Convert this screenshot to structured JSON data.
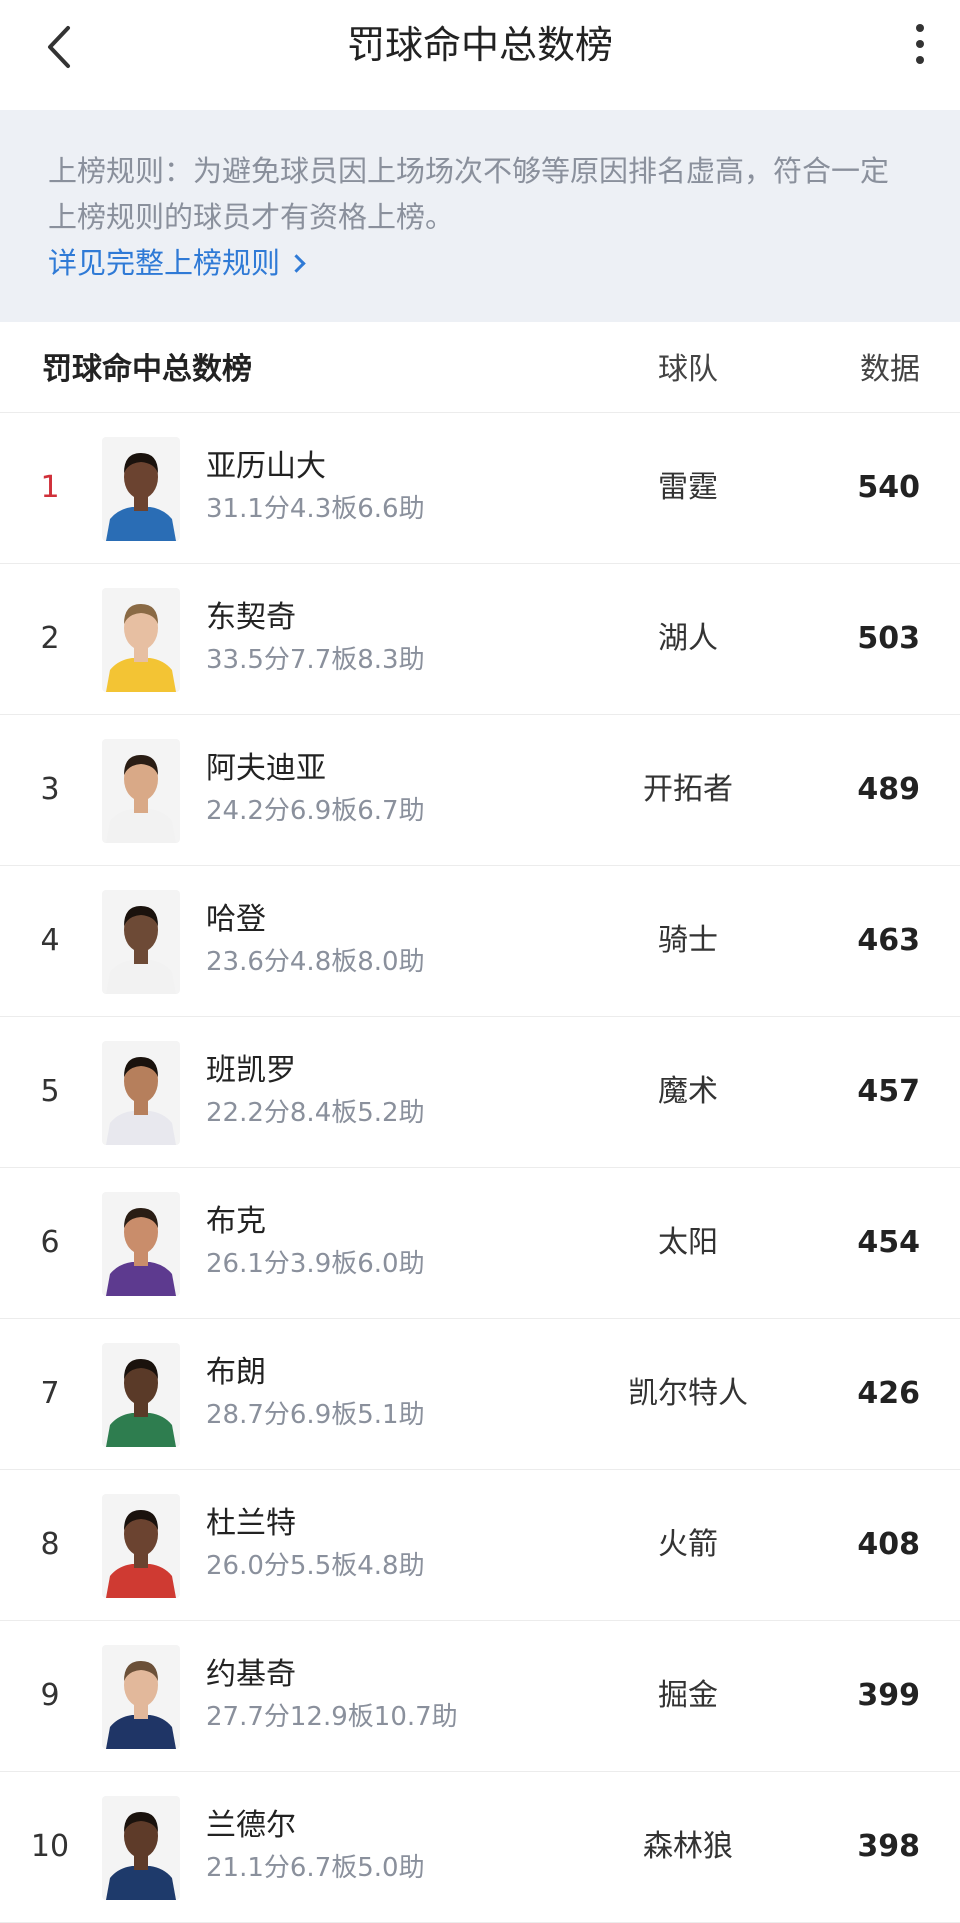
{
  "top_bar": {
    "title": "罚球命中总数榜"
  },
  "rules": {
    "text": "上榜规则：为避免球员因上场场次不够等原因排名虚高，符合一定上榜规则的球员才有资格上榜。",
    "link_label": "详见完整上榜规则"
  },
  "table": {
    "title": "罚球命中总数榜",
    "team_header": "球队",
    "stat_header": "数据"
  },
  "players": [
    {
      "rank": "1",
      "name": "亚历山大",
      "stats": "31.1分4.3板6.6助",
      "team": "雷霆",
      "value": "540",
      "skin": "#6b4330",
      "jersey": "#2a6db5",
      "hair": "#1a120d"
    },
    {
      "rank": "2",
      "name": "东契奇",
      "stats": "33.5分7.7板8.3助",
      "team": "湖人",
      "value": "503",
      "skin": "#e7bfa2",
      "jersey": "#f3c434",
      "hair": "#8a6a45"
    },
    {
      "rank": "3",
      "name": "阿夫迪亚",
      "stats": "24.2分6.9板6.7助",
      "team": "开拓者",
      "value": "489",
      "skin": "#d9a987",
      "jersey": "#f2f2f2",
      "hair": "#2a1d14"
    },
    {
      "rank": "4",
      "name": "哈登",
      "stats": "23.6分4.8板8.0助",
      "team": "骑士",
      "value": "463",
      "skin": "#6d4a36",
      "jersey": "#f2f2f2",
      "hair": "#1a120d"
    },
    {
      "rank": "5",
      "name": "班凯罗",
      "stats": "22.2分8.4板5.2助",
      "team": "魔术",
      "value": "457",
      "skin": "#b67f5c",
      "jersey": "#e8e8ee",
      "hair": "#1a120d"
    },
    {
      "rank": "6",
      "name": "布克",
      "stats": "26.1分3.9板6.0助",
      "team": "太阳",
      "value": "454",
      "skin": "#c98d6b",
      "jersey": "#5d3a8f",
      "hair": "#2a1d14"
    },
    {
      "rank": "7",
      "name": "布朗",
      "stats": "28.7分6.9板5.1助",
      "team": "凯尔特人",
      "value": "426",
      "skin": "#5a3a28",
      "jersey": "#2e7d4f",
      "hair": "#1a120d"
    },
    {
      "rank": "8",
      "name": "杜兰特",
      "stats": "26.0分5.5板4.8助",
      "team": "火箭",
      "value": "408",
      "skin": "#6b4330",
      "jersey": "#cf3a32",
      "hair": "#1a120d"
    },
    {
      "rank": "9",
      "name": "约基奇",
      "stats": "27.7分12.9板10.7助",
      "team": "掘金",
      "value": "399",
      "skin": "#e2b89b",
      "jersey": "#1f3566",
      "hair": "#6b5038"
    },
    {
      "rank": "10",
      "name": "兰德尔",
      "stats": "21.1分6.7板5.0助",
      "team": "森林狼",
      "value": "398",
      "skin": "#5e3b29",
      "jersey": "#1e3a6b",
      "hair": "#1a120d"
    }
  ]
}
